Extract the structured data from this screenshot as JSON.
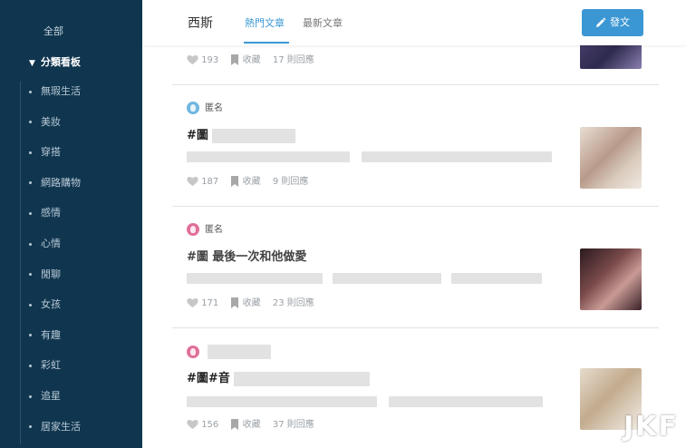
{
  "sidebar": {
    "all_label": "全部",
    "category_label": "分類看板",
    "items": [
      {
        "label": "無瑕生活"
      },
      {
        "label": "美妝"
      },
      {
        "label": "穿搭"
      },
      {
        "label": "網路購物"
      },
      {
        "label": "感情"
      },
      {
        "label": "心情"
      },
      {
        "label": "閒聊"
      },
      {
        "label": "女孩"
      },
      {
        "label": "有趣"
      },
      {
        "label": "彩虹"
      },
      {
        "label": "追星"
      },
      {
        "label": "居家生活"
      }
    ]
  },
  "header": {
    "board_title": "西斯",
    "tabs": [
      {
        "label": "熱門文章",
        "active": true
      },
      {
        "label": "最新文章",
        "active": false
      }
    ],
    "post_button_label": "發文"
  },
  "posts": [
    {
      "likes": "193",
      "bookmark_label": "收藏",
      "comments": "17 則回應"
    },
    {
      "author": "匿名",
      "avatar_color": "#6fb7e0",
      "title": "#圖",
      "likes": "187",
      "bookmark_label": "收藏",
      "comments": "9 則回應"
    },
    {
      "author": "匿名",
      "avatar_color": "#e06f9a",
      "title": "#圖 最後一次和他做愛",
      "likes": "171",
      "bookmark_label": "收藏",
      "comments": "23 則回應"
    },
    {
      "author": "",
      "avatar_color": "#e06f9a",
      "title": "#圖#音",
      "likes": "156",
      "bookmark_label": "收藏",
      "comments": "37 則回應"
    }
  ],
  "watermark": "JKF"
}
